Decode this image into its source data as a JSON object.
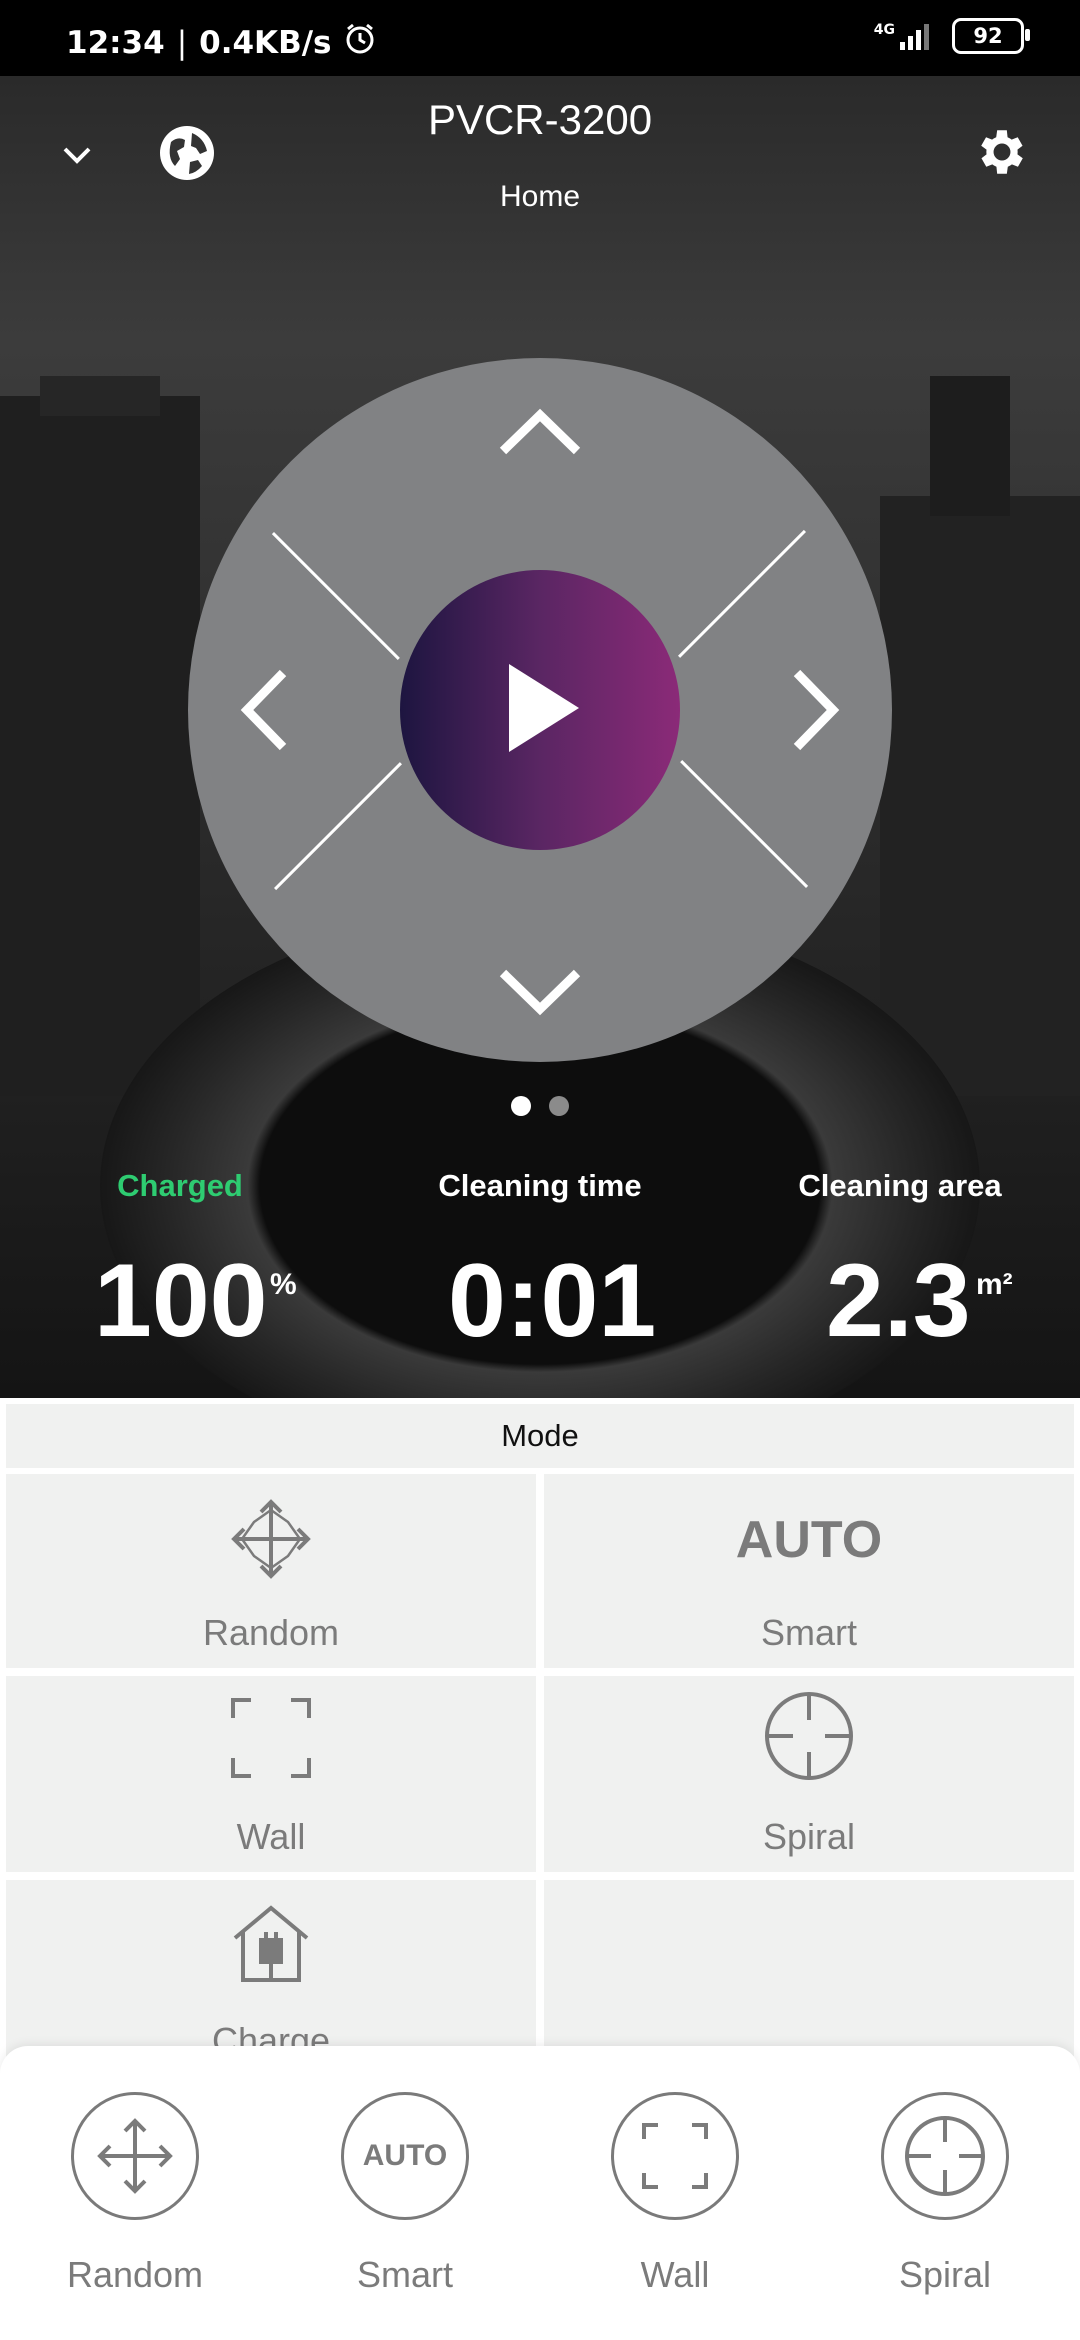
{
  "status_bar": {
    "time": "12:34",
    "separator": "|",
    "net_speed": "0.4KB/s",
    "network": "4G",
    "battery": "92"
  },
  "header": {
    "title": "PVCR-3200",
    "subtitle": "Home",
    "icons": [
      "chevron-down-icon",
      "globe-icon",
      "gear-icon"
    ]
  },
  "control": {
    "icons": [
      "arrow-up-icon",
      "arrow-down-icon",
      "arrow-left-icon",
      "arrow-right-icon",
      "play-icon"
    ],
    "pager_pages": 2,
    "pager_active": 0
  },
  "stats": {
    "charge": {
      "label": "Charged",
      "value": "100",
      "unit": "%",
      "label_color": "#2ecc71"
    },
    "time": {
      "label": "Cleaning time",
      "value": "0:01"
    },
    "area": {
      "label": "Cleaning area",
      "value": "2.3",
      "unit": "m²"
    }
  },
  "mode": {
    "header": "Mode",
    "items": [
      {
        "label": "Random",
        "icon": "move-arrows-icon"
      },
      {
        "label": "Smart",
        "icon_text": "AUTO"
      },
      {
        "label": "Wall",
        "icon": "corners-frame-icon"
      },
      {
        "label": "Spiral",
        "icon": "crosshair-icon"
      },
      {
        "label": "Charge",
        "icon": "home-plug-icon"
      }
    ]
  },
  "bottom_bar": {
    "items": [
      {
        "label": "Random",
        "icon": "move-arrows-icon"
      },
      {
        "label": "Smart",
        "icon_text": "AUTO"
      },
      {
        "label": "Wall",
        "icon": "corners-frame-icon"
      },
      {
        "label": "Spiral",
        "icon": "crosshair-icon"
      }
    ]
  }
}
